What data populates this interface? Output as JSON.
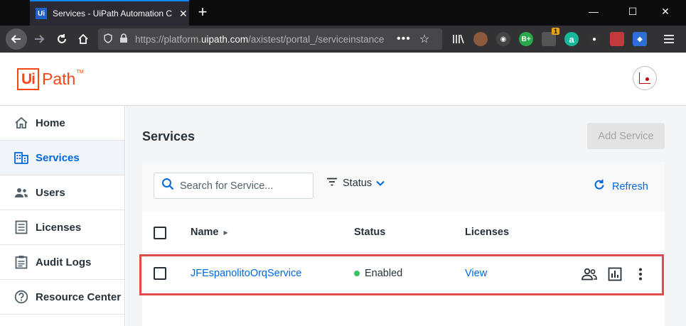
{
  "browser": {
    "tab_title": "Services - UiPath Automation C",
    "tab_favicon": "Ui",
    "url_prefix": "https://platform.",
    "url_domain": "uipath.com",
    "url_path": "/axistest/portal_/serviceinstance",
    "url_more": "•••",
    "ext_badge": "1",
    "ext_bplus": "B+",
    "ext_a": "a"
  },
  "app": {
    "logo_box": "Ui",
    "logo_text": "Path",
    "logo_tm": "TM"
  },
  "sidebar": {
    "items": [
      {
        "label": "Home",
        "icon": "home-icon"
      },
      {
        "label": "Services",
        "icon": "building-icon",
        "active": true
      },
      {
        "label": "Users",
        "icon": "users-icon"
      },
      {
        "label": "Licenses",
        "icon": "license-icon"
      },
      {
        "label": "Audit Logs",
        "icon": "clipboard-icon"
      },
      {
        "label": "Resource Center",
        "icon": "help-icon"
      }
    ]
  },
  "main": {
    "title": "Services",
    "add_button": "Add Service",
    "search_placeholder": "Search for Service...",
    "status_filter": "Status",
    "refresh": "Refresh",
    "columns": {
      "name": "Name",
      "status": "Status",
      "licenses": "Licenses"
    },
    "rows": [
      {
        "name": "JFEspanolitoOrqService",
        "status": "Enabled",
        "licenses": "View"
      }
    ]
  },
  "colors": {
    "accent": "#0067df",
    "brand": "#fa4616",
    "enabled": "#38c15f",
    "highlight": "#e04b4b"
  }
}
